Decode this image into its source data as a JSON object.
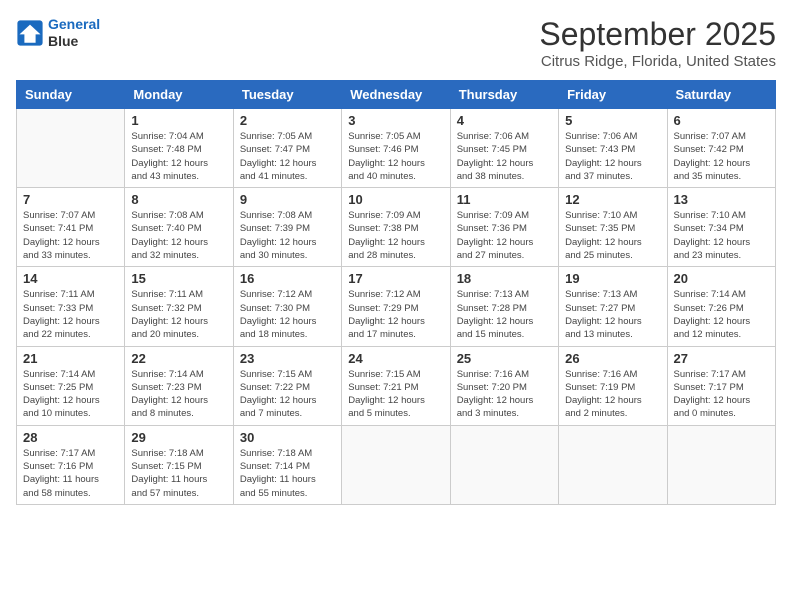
{
  "header": {
    "logo_line1": "General",
    "logo_line2": "Blue",
    "main_title": "September 2025",
    "subtitle": "Citrus Ridge, Florida, United States"
  },
  "calendar": {
    "days_of_week": [
      "Sunday",
      "Monday",
      "Tuesday",
      "Wednesday",
      "Thursday",
      "Friday",
      "Saturday"
    ],
    "weeks": [
      [
        {
          "day": "",
          "info": ""
        },
        {
          "day": "1",
          "info": "Sunrise: 7:04 AM\nSunset: 7:48 PM\nDaylight: 12 hours\nand 43 minutes."
        },
        {
          "day": "2",
          "info": "Sunrise: 7:05 AM\nSunset: 7:47 PM\nDaylight: 12 hours\nand 41 minutes."
        },
        {
          "day": "3",
          "info": "Sunrise: 7:05 AM\nSunset: 7:46 PM\nDaylight: 12 hours\nand 40 minutes."
        },
        {
          "day": "4",
          "info": "Sunrise: 7:06 AM\nSunset: 7:45 PM\nDaylight: 12 hours\nand 38 minutes."
        },
        {
          "day": "5",
          "info": "Sunrise: 7:06 AM\nSunset: 7:43 PM\nDaylight: 12 hours\nand 37 minutes."
        },
        {
          "day": "6",
          "info": "Sunrise: 7:07 AM\nSunset: 7:42 PM\nDaylight: 12 hours\nand 35 minutes."
        }
      ],
      [
        {
          "day": "7",
          "info": "Sunrise: 7:07 AM\nSunset: 7:41 PM\nDaylight: 12 hours\nand 33 minutes."
        },
        {
          "day": "8",
          "info": "Sunrise: 7:08 AM\nSunset: 7:40 PM\nDaylight: 12 hours\nand 32 minutes."
        },
        {
          "day": "9",
          "info": "Sunrise: 7:08 AM\nSunset: 7:39 PM\nDaylight: 12 hours\nand 30 minutes."
        },
        {
          "day": "10",
          "info": "Sunrise: 7:09 AM\nSunset: 7:38 PM\nDaylight: 12 hours\nand 28 minutes."
        },
        {
          "day": "11",
          "info": "Sunrise: 7:09 AM\nSunset: 7:36 PM\nDaylight: 12 hours\nand 27 minutes."
        },
        {
          "day": "12",
          "info": "Sunrise: 7:10 AM\nSunset: 7:35 PM\nDaylight: 12 hours\nand 25 minutes."
        },
        {
          "day": "13",
          "info": "Sunrise: 7:10 AM\nSunset: 7:34 PM\nDaylight: 12 hours\nand 23 minutes."
        }
      ],
      [
        {
          "day": "14",
          "info": "Sunrise: 7:11 AM\nSunset: 7:33 PM\nDaylight: 12 hours\nand 22 minutes."
        },
        {
          "day": "15",
          "info": "Sunrise: 7:11 AM\nSunset: 7:32 PM\nDaylight: 12 hours\nand 20 minutes."
        },
        {
          "day": "16",
          "info": "Sunrise: 7:12 AM\nSunset: 7:30 PM\nDaylight: 12 hours\nand 18 minutes."
        },
        {
          "day": "17",
          "info": "Sunrise: 7:12 AM\nSunset: 7:29 PM\nDaylight: 12 hours\nand 17 minutes."
        },
        {
          "day": "18",
          "info": "Sunrise: 7:13 AM\nSunset: 7:28 PM\nDaylight: 12 hours\nand 15 minutes."
        },
        {
          "day": "19",
          "info": "Sunrise: 7:13 AM\nSunset: 7:27 PM\nDaylight: 12 hours\nand 13 minutes."
        },
        {
          "day": "20",
          "info": "Sunrise: 7:14 AM\nSunset: 7:26 PM\nDaylight: 12 hours\nand 12 minutes."
        }
      ],
      [
        {
          "day": "21",
          "info": "Sunrise: 7:14 AM\nSunset: 7:25 PM\nDaylight: 12 hours\nand 10 minutes."
        },
        {
          "day": "22",
          "info": "Sunrise: 7:14 AM\nSunset: 7:23 PM\nDaylight: 12 hours\nand 8 minutes."
        },
        {
          "day": "23",
          "info": "Sunrise: 7:15 AM\nSunset: 7:22 PM\nDaylight: 12 hours\nand 7 minutes."
        },
        {
          "day": "24",
          "info": "Sunrise: 7:15 AM\nSunset: 7:21 PM\nDaylight: 12 hours\nand 5 minutes."
        },
        {
          "day": "25",
          "info": "Sunrise: 7:16 AM\nSunset: 7:20 PM\nDaylight: 12 hours\nand 3 minutes."
        },
        {
          "day": "26",
          "info": "Sunrise: 7:16 AM\nSunset: 7:19 PM\nDaylight: 12 hours\nand 2 minutes."
        },
        {
          "day": "27",
          "info": "Sunrise: 7:17 AM\nSunset: 7:17 PM\nDaylight: 12 hours\nand 0 minutes."
        }
      ],
      [
        {
          "day": "28",
          "info": "Sunrise: 7:17 AM\nSunset: 7:16 PM\nDaylight: 11 hours\nand 58 minutes."
        },
        {
          "day": "29",
          "info": "Sunrise: 7:18 AM\nSunset: 7:15 PM\nDaylight: 11 hours\nand 57 minutes."
        },
        {
          "day": "30",
          "info": "Sunrise: 7:18 AM\nSunset: 7:14 PM\nDaylight: 11 hours\nand 55 minutes."
        },
        {
          "day": "",
          "info": ""
        },
        {
          "day": "",
          "info": ""
        },
        {
          "day": "",
          "info": ""
        },
        {
          "day": "",
          "info": ""
        }
      ]
    ]
  }
}
